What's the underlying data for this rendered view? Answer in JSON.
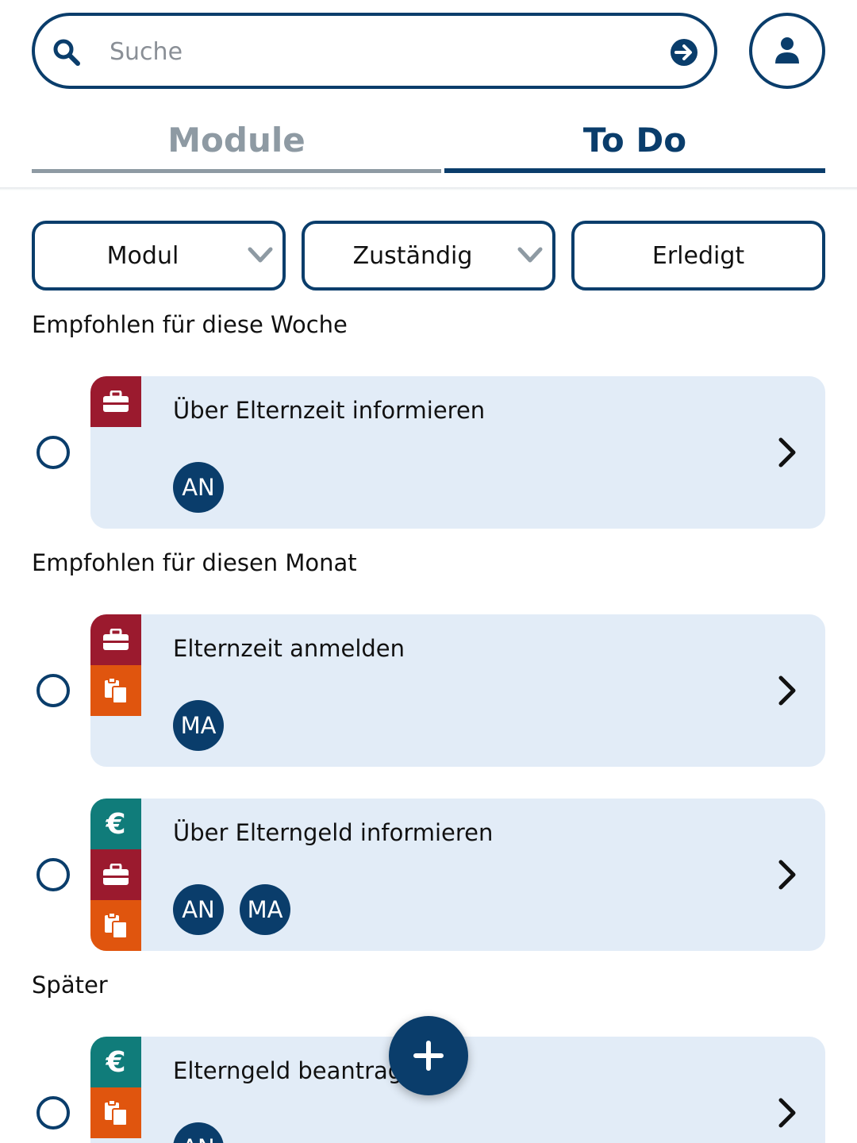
{
  "search": {
    "placeholder": "Suche"
  },
  "tabs": [
    {
      "label": "Module",
      "active": false
    },
    {
      "label": "To Do",
      "active": true
    }
  ],
  "filters": {
    "modul": "Modul",
    "zustaendig": "Zuständig",
    "erledigt": "Erledigt"
  },
  "sections": [
    {
      "title": "Empfohlen für diese Woche",
      "items": [
        {
          "title": "Über Elternzeit informieren",
          "tags": [
            "briefcase-icon"
          ],
          "assignees": [
            "AN"
          ]
        }
      ]
    },
    {
      "title": "Empfohlen für diesen Monat",
      "items": [
        {
          "title": "Elternzeit anmelden",
          "tags": [
            "briefcase-icon",
            "documents-icon"
          ],
          "assignees": [
            "MA"
          ]
        },
        {
          "title": "Über Elterngeld informieren",
          "tags": [
            "euro-icon",
            "briefcase-icon",
            "documents-icon"
          ],
          "assignees": [
            "AN",
            "MA"
          ]
        }
      ]
    },
    {
      "title": "Später",
      "items": [
        {
          "title": "Elterngeld beantragen",
          "tags": [
            "euro-icon",
            "documents-icon"
          ],
          "assignees": [
            "AN"
          ]
        }
      ]
    }
  ],
  "tag_symbols": {
    "euro": "€"
  },
  "colors": {
    "primary": "#0a3d6b",
    "job": "#9b1a2e",
    "documents": "#e0550e",
    "money": "#107c7a",
    "card_bg": "#e2ecf7"
  }
}
